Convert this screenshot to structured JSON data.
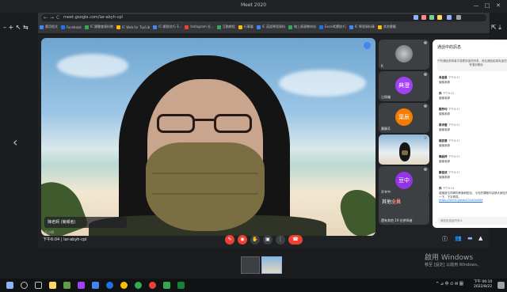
{
  "window": {
    "title": "Meet 2020",
    "minimize": "—",
    "maximize": "□",
    "close": "✕"
  },
  "browser": {
    "nav_back": "←",
    "nav_forward": "→",
    "nav_reload": "C",
    "url": "meet.google.com/lar-abyh-cpl",
    "side_left": "– + ↖ ⇆",
    "side_right": "⇱ ⤓",
    "bookmarks": [
      {
        "label": "應用程式",
        "color": "#4285f4"
      },
      {
        "label": "Facebook",
        "color": "#1877f2"
      },
      {
        "label": "IC 讀書會資料教",
        "color": "#34a853"
      },
      {
        "label": "IC Web for Tip/Lib",
        "color": "#fbbc04"
      },
      {
        "label": "IC 開發技巧-3...",
        "color": "#4285f4"
      },
      {
        "label": "Instagram 社...",
        "color": "#ea4335"
      },
      {
        "label": "互動教程",
        "color": "#34a853"
      },
      {
        "label": "行事曆",
        "color": "#fbbc04"
      },
      {
        "label": "IC 英語學習資料",
        "color": "#4285f4"
      },
      {
        "label": "線上資源教材站",
        "color": "#34a853"
      },
      {
        "label": "Excel相關技巧",
        "color": "#1a73e8"
      },
      {
        "label": "IC 學習資料庫",
        "color": "#4285f4"
      },
      {
        "label": "其他書籤",
        "color": "#fbbc04"
      }
    ]
  },
  "main_video": {
    "name": "陳老師 (簡報者)",
    "sub": "王小明"
  },
  "participants": [
    {
      "label": "R",
      "avatar": "",
      "color": "#6d6d6d",
      "type": "photo"
    },
    {
      "label": "江佩儀",
      "avatar": "典澄",
      "color": "#a142f4",
      "type": "avatar"
    },
    {
      "label": "葉靜芳",
      "avatar": "葉辰",
      "color": "#f57c00",
      "type": "avatar"
    },
    {
      "label": "",
      "avatar": "",
      "color": "",
      "type": "video"
    },
    {
      "label": "巫宜中",
      "avatar": "豆中",
      "color": "#9334e6",
      "type": "avatar"
    }
  ],
  "group_tile": {
    "prefix": "其他",
    "name": "全員",
    "label": "還有其他 19 位參與者"
  },
  "chat": {
    "title": "通話中的訊息",
    "close": "✕",
    "notice": "只有通話參與者才能看到這些訊息，而且通話結束後這些訊息將會遭到刪除",
    "messages": [
      {
        "who": "吳佳恩",
        "time": "下午6:32",
        "text": "謝謝老師"
      },
      {
        "who": "你",
        "time": "下午6:32",
        "text": "謝謝老師"
      },
      {
        "who": "劉芳均",
        "time": "下午6:32",
        "text": "謝謝老師"
      },
      {
        "who": "蔡沛萱",
        "time": "下午6:32",
        "text": "謝謝老師"
      },
      {
        "who": "楊宜蓉",
        "time": "下午6:33",
        "text": "謝謝老師"
      },
      {
        "who": "陳品妤",
        "time": "下午6:33",
        "text": "謝謝老師"
      },
      {
        "who": "鄭佳欣",
        "time": "下午6:33",
        "text": "謝謝老師"
      },
      {
        "who": "你",
        "time": "下午6:34",
        "text": "感謝各位同學的參與和配合，今天的課程內容請大家回去複習一下，下次再見。",
        "link": "https://forms.gle/ab12cd34ef56"
      }
    ],
    "input_placeholder": "傳送訊息給所有人",
    "send": "▷"
  },
  "controls": {
    "meeting_info": "下午6:04 | lar-abyh-cpl",
    "buttons": [
      "✎",
      "◉",
      "✋",
      "▣",
      "⋮",
      "☎"
    ],
    "right": [
      "ⓘ",
      "👥",
      "▬",
      "▲"
    ]
  },
  "watermark": {
    "title": "啟用 Windows",
    "sub": "移至 [設定] 以啟用 Windows。"
  },
  "taskbar": {
    "clock_time": "下午 06:10",
    "clock_date": "2022/8/22",
    "tray_text": "^ ⊿ 中 ∅ ✉ 圖"
  },
  "nav_arrows": {
    "left": "‹",
    "right": "›"
  }
}
